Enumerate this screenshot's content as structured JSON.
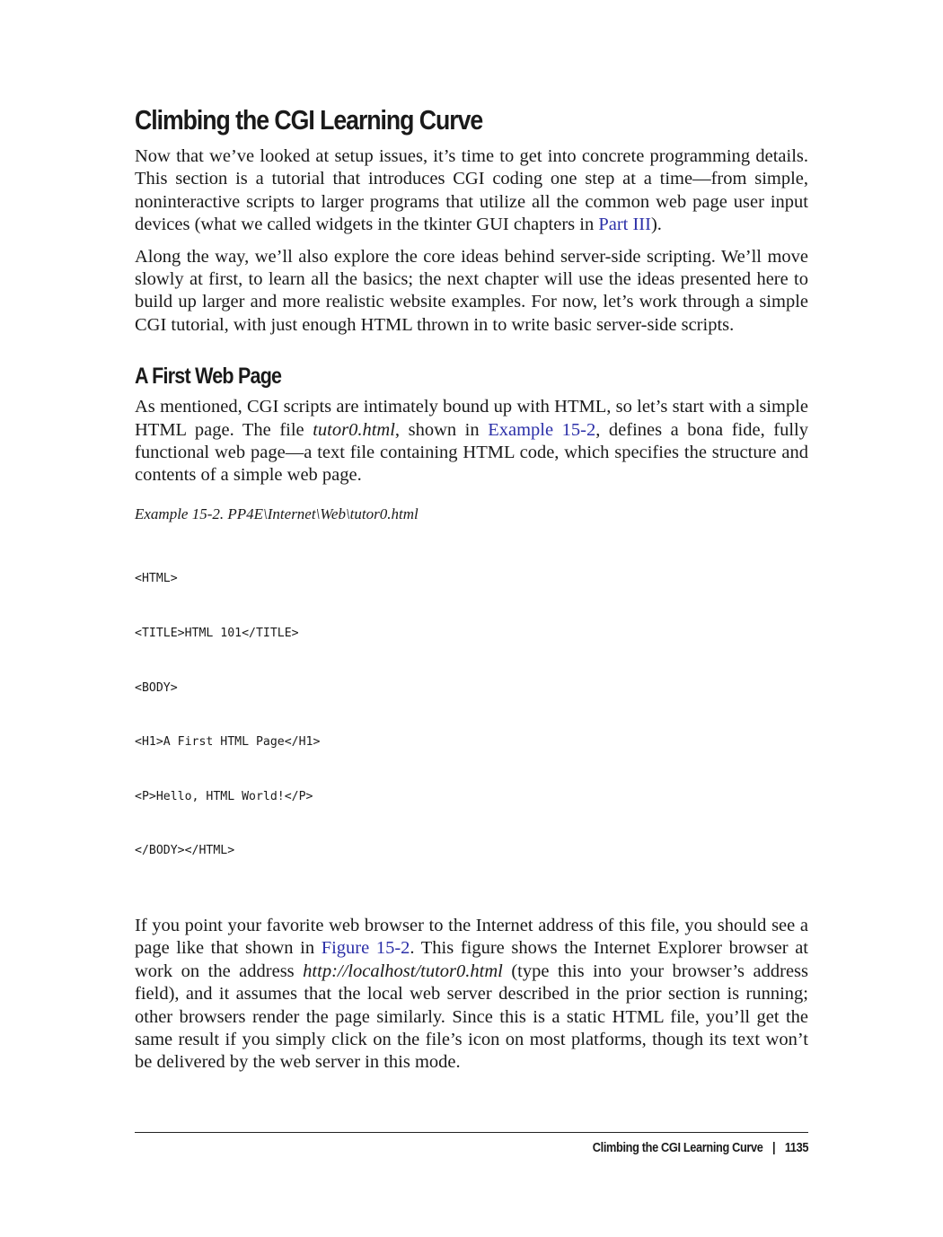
{
  "section": {
    "title": "Climbing the CGI Learning Curve",
    "p1": {
      "before_link": "Now that we’ve looked at setup issues, it’s time to get into concrete programming details. This section is a tutorial that introduces CGI coding one step at a time—from simple, noninteractive scripts to larger programs that utilize all the common web page user input devices (what we called widgets in the tkinter GUI chapters in ",
      "link": "Part III",
      "after_link": ")."
    },
    "p2": "Along the way, we’ll also explore the core ideas behind server-side scripting. We’ll move slowly at first, to learn all the basics; the next chapter will use the ideas presented here to build up larger and more realistic website examples. For now, let’s work through a simple CGI tutorial, with just enough HTML thrown in to write basic server-side scripts."
  },
  "subsection": {
    "title": "A First Web Page",
    "p1": {
      "text1": "As mentioned, CGI scripts are intimately bound up with HTML, so let’s start with a simple HTML page. The file ",
      "filename": "tutor0.html",
      "text2": ", shown in ",
      "link": "Example 15-2",
      "text3": ", defines a bona fide, fully functional web page—a text file containing HTML code, which specifies the structure and contents of a simple web page."
    },
    "example_caption": "Example 15-2. PP4E\\Internet\\Web\\tutor0.html",
    "code_lines": [
      "<HTML>",
      "<TITLE>HTML 101</TITLE>",
      "<BODY>",
      "<H1>A First HTML Page</H1>",
      "<P>Hello, HTML World!</P>",
      "</BODY></HTML>"
    ],
    "p2": {
      "text1": "If you point your favorite web browser to the Internet address of this file, you should see a page like that shown in ",
      "link": "Figure 15-2",
      "text2": ". This figure shows the Internet Explorer browser at work on the address ",
      "url": "http://localhost/tutor0.html",
      "text3": " (type this into your browser’s address field), and it assumes that the local web server described in the prior section is running; other browsers render the page similarly. Since this is a static HTML file, you’ll get the same result if you simply click on the file’s icon on most platforms, though its text won’t be delivered by the web server in this mode."
    }
  },
  "footer": {
    "running_title": "Climbing the CGI Learning Curve",
    "separator": "|",
    "page_number": "1135"
  },
  "colors": {
    "link": "#2b2fa8",
    "text": "#1a1a1a"
  }
}
